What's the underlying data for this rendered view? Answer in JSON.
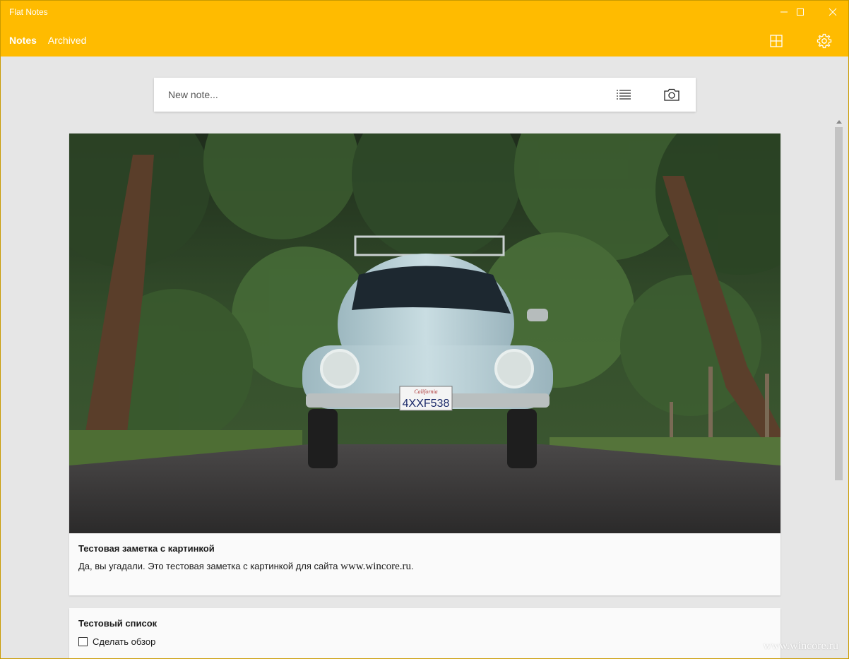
{
  "window": {
    "title": "Flat Notes",
    "accent_color": "#ffbb00",
    "controls": {
      "minimize_icon": "minimize-icon",
      "maximize_icon": "maximize-icon",
      "close_icon": "close-icon"
    }
  },
  "header": {
    "tabs": [
      {
        "label": "Notes",
        "active": true
      },
      {
        "label": "Archived",
        "active": false
      }
    ],
    "icons": [
      "grid-view-icon",
      "gear-icon"
    ]
  },
  "new_note": {
    "placeholder": "New note...",
    "list_icon": "checklist-icon",
    "camera_icon": "camera-icon"
  },
  "notes": [
    {
      "type": "image-note",
      "image": "vintage-car-photo",
      "image_plate_text": "4XXF538",
      "image_plate_state": "California",
      "title": "Тестовая заметка с картинкой",
      "text_before": "Да, вы угадали. Это тестовая заметка с картинкой для сайта ",
      "text_link": "www.wincore.ru",
      "text_after": "."
    },
    {
      "type": "checklist",
      "title": "Тестовый список",
      "items": [
        {
          "label": "Сделать обзор",
          "checked": false
        }
      ]
    }
  ],
  "watermark": "www.wincore.ru"
}
